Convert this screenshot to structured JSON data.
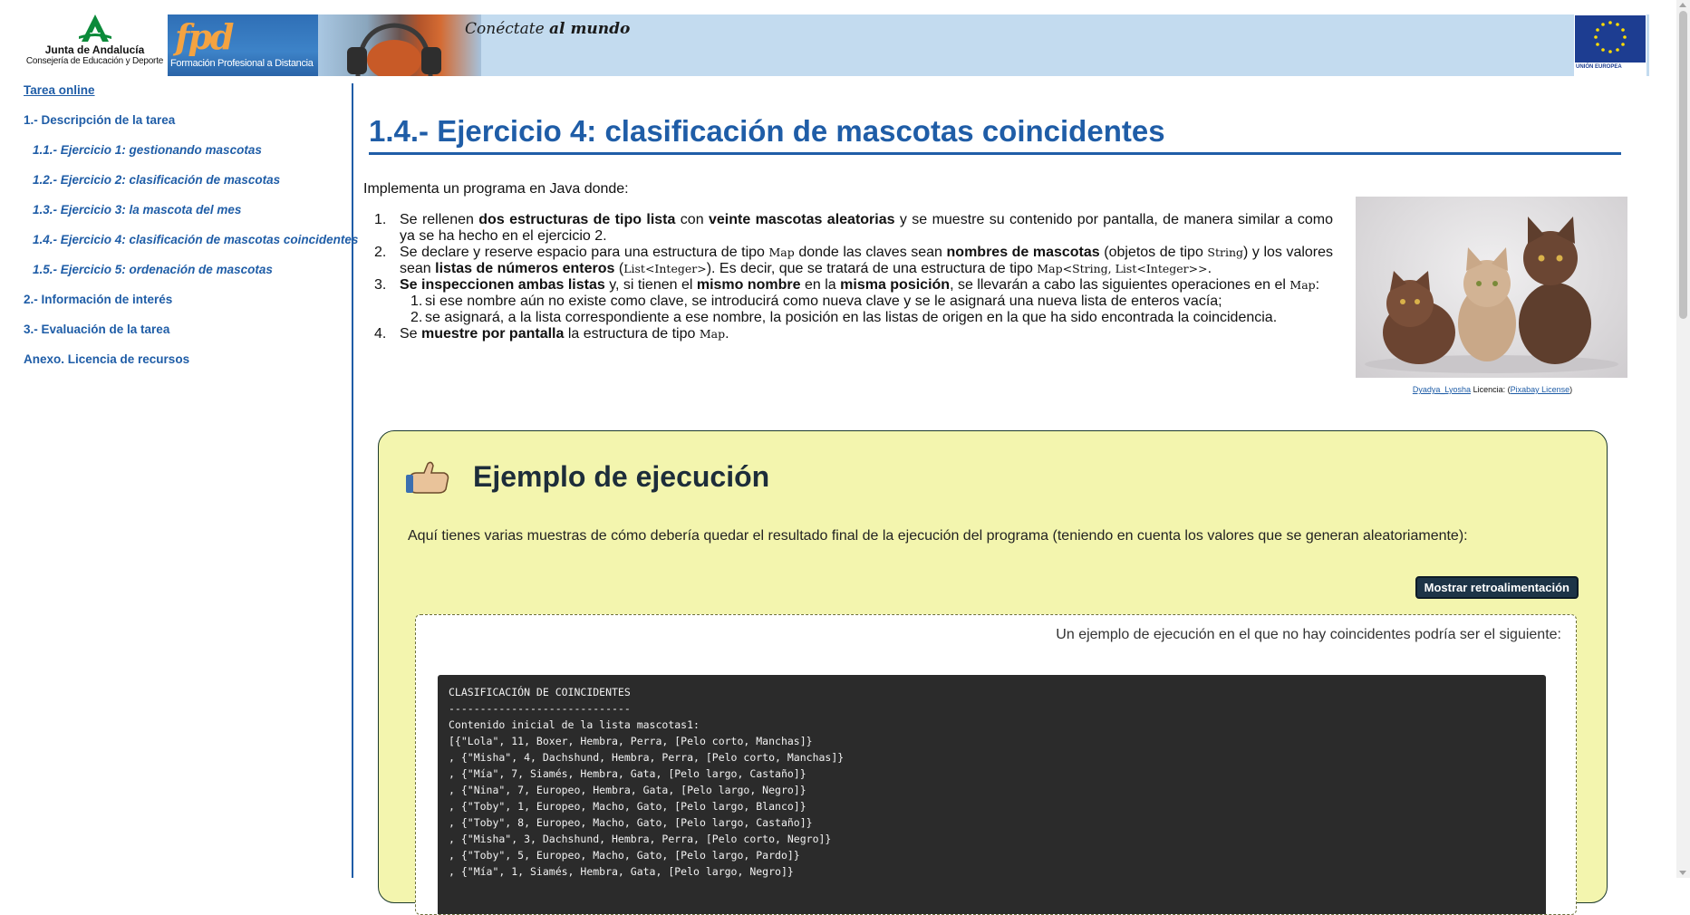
{
  "header": {
    "junta_name": "Junta de Andalucía",
    "junta_sub": "Consejería de Educación y Deporte",
    "fpd_logo": "fpd",
    "fpd_text": "Formación Profesional a Distancia",
    "slogan_start": "Conéctate",
    "slogan_end": "al mundo",
    "eu_label": "UNIÓN EUROPEA"
  },
  "sidebar": {
    "online": "Tarea online",
    "items": [
      {
        "label": "1.- Descripción de la tarea"
      },
      {
        "label": "1.1.- Ejercicio 1: gestionando mascotas"
      },
      {
        "label": "1.2.- Ejercicio 2: clasificación de mascotas"
      },
      {
        "label": "1.3.- Ejercicio 3: la mascota del mes"
      },
      {
        "label": "1.4.- Ejercicio 4: clasificación de mascotas coincidentes"
      },
      {
        "label": "1.5.- Ejercicio 5: ordenación de mascotas"
      },
      {
        "label": "2.- Información de interés"
      },
      {
        "label": "3.- Evaluación de la tarea"
      },
      {
        "label": "Anexo. Licencia de recursos"
      }
    ]
  },
  "main": {
    "title": "1.4.- Ejercicio 4: clasificación de mascotas coincidentes",
    "intro": "Implementa un programa en Java donde:",
    "list": [
      {
        "num": "1.",
        "t1": "Se rellenen ",
        "b1": "dos estructuras de tipo lista",
        "t2": " con ",
        "b2": "veinte mascotas aleatorias",
        "t3": " y se muestre su contenido por pantalla, de manera similar a como ya se ha hecho en el ejercicio 2."
      },
      {
        "num": "2.",
        "t1": "Se declare y reserve espacio para una estructura de tipo ",
        "c1": "Map",
        "t2": " donde las claves sean ",
        "b1": "nombres de mascotas",
        "t3": " (objetos de tipo ",
        "c2": "String",
        "t4": ") y los valores sean ",
        "b2": "listas de números enteros",
        "t5": " (",
        "c3": "List<Integer>",
        "t6": "). Es decir, que se tratará de una estructura de tipo ",
        "c4": "Map<String, List<Integer>>",
        "t7": "."
      },
      {
        "num": "3.",
        "b1": "Se inspeccionen ambas listas",
        "t1": " y, si tienen el ",
        "b2": "mismo nombre",
        "t2": " en la ",
        "b3": "misma posición",
        "t3": ", se llevarán a cabo las siguientes operaciones en el ",
        "c1": "Map",
        "t4": ":"
      },
      {
        "num": "4.",
        "t1": "Se ",
        "b1": "muestre por pantalla",
        "t2": " la estructura de tipo ",
        "c1": "Map",
        "t3": "."
      }
    ],
    "sublist": [
      {
        "num": "1.",
        "text": "si ese nombre aún no existe como clave, se introducirá como nueva clave y se le asignará una nueva lista de enteros vacía;"
      },
      {
        "num": "2.",
        "text": "se asignará, a la lista correspondiente a ese nombre, la posición en las listas de origen en la que ha sido encontrada la coincidencia."
      }
    ],
    "caption": {
      "author": "Dyadya_Lyosha",
      "middle": " Licencia: (",
      "license": "Pixabay License",
      "end": ")"
    }
  },
  "example": {
    "title": "Ejemplo de ejecución",
    "description": "Aquí tienes varias muestras de cómo debería quedar el resultado final de la ejecución del programa (teniendo en cuenta los valores que se generan aleatoriamente):",
    "feedback_button": "Mostrar retroalimentación",
    "sample_intro": "Un ejemplo de ejecución en el que no hay coincidentes podría ser el siguiente:",
    "console_lines": [
      "CLASIFICACIÓN DE COINCIDENTES",
      "-----------------------------",
      "Contenido inicial de la lista mascotas1:",
      "[{\"Lola\", 11, Boxer, Hembra, Perra, [Pelo corto, Manchas]}",
      ", {\"Misha\", 4, Dachshund, Hembra, Perra, [Pelo corto, Manchas]}",
      ", {\"Mía\", 7, Siamés, Hembra, Gata, [Pelo largo, Castaño]}",
      ", {\"Nina\", 7, Europeo, Hembra, Gata, [Pelo largo, Negro]}",
      ", {\"Toby\", 1, Europeo, Macho, Gato, [Pelo largo, Blanco]}",
      ", {\"Toby\", 8, Europeo, Macho, Gato, [Pelo largo, Castaño]}",
      ", {\"Misha\", 3, Dachshund, Hembra, Perra, [Pelo corto, Negro]}",
      ", {\"Toby\", 5, Europeo, Macho, Gato, [Pelo largo, Pardo]}",
      ", {\"Mía\", 1, Siamés, Hembra, Gata, [Pelo largo, Negro]}"
    ]
  },
  "colors": {
    "accent": "#1f5da7",
    "example_bg": "#f3f5ae",
    "console_bg": "#2b2b2b",
    "button_bg": "#1d3447"
  },
  "icons": [
    "junta-logo-icon",
    "eu-flag-icon",
    "thumbs-up-icon"
  ]
}
